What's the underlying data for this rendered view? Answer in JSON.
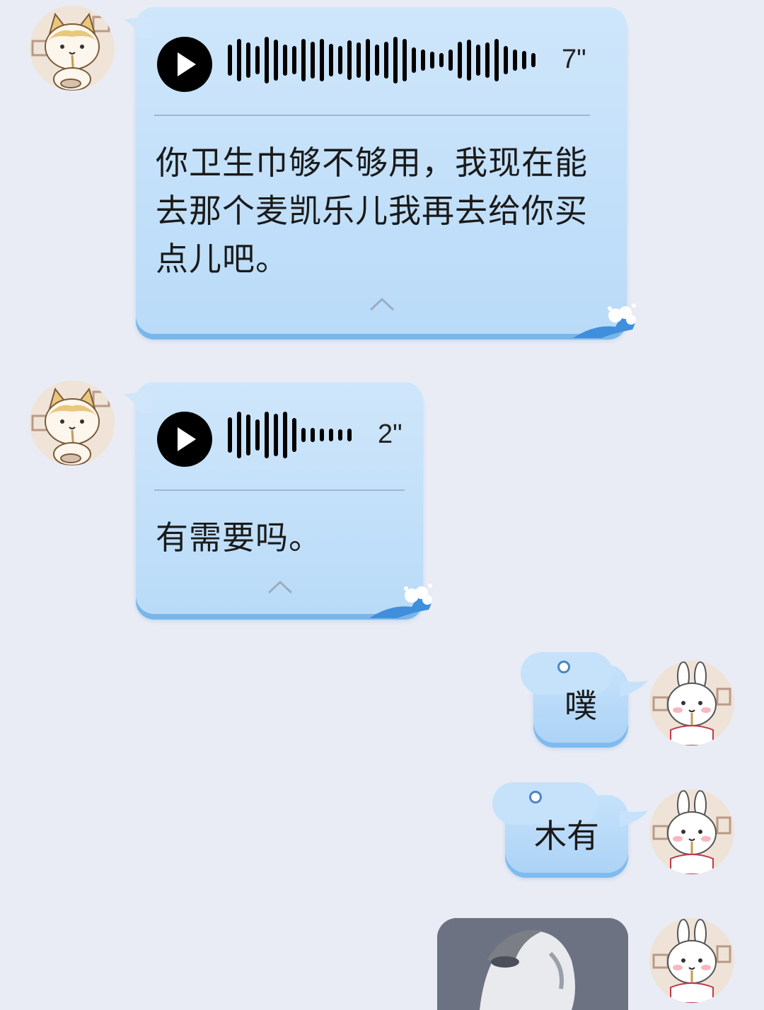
{
  "messages": [
    {
      "type": "voice",
      "side": "left",
      "duration": "7\"",
      "transcript": "你卫生巾够不够用，我现在能去那个麦凯乐儿我再去给你买点儿吧。"
    },
    {
      "type": "voice",
      "side": "left",
      "duration": "2\"",
      "transcript": "有需要吗。"
    },
    {
      "type": "text",
      "side": "right",
      "text": "噗"
    },
    {
      "type": "text",
      "side": "right",
      "text": "木有"
    },
    {
      "type": "image",
      "side": "right"
    }
  ],
  "icons": {
    "play": "play-icon",
    "collapse": "chevron-up-icon"
  },
  "colors": {
    "background": "#e9ecf5",
    "bubble": "#c6e2fb",
    "bubble_shadow": "#79b6ea"
  }
}
